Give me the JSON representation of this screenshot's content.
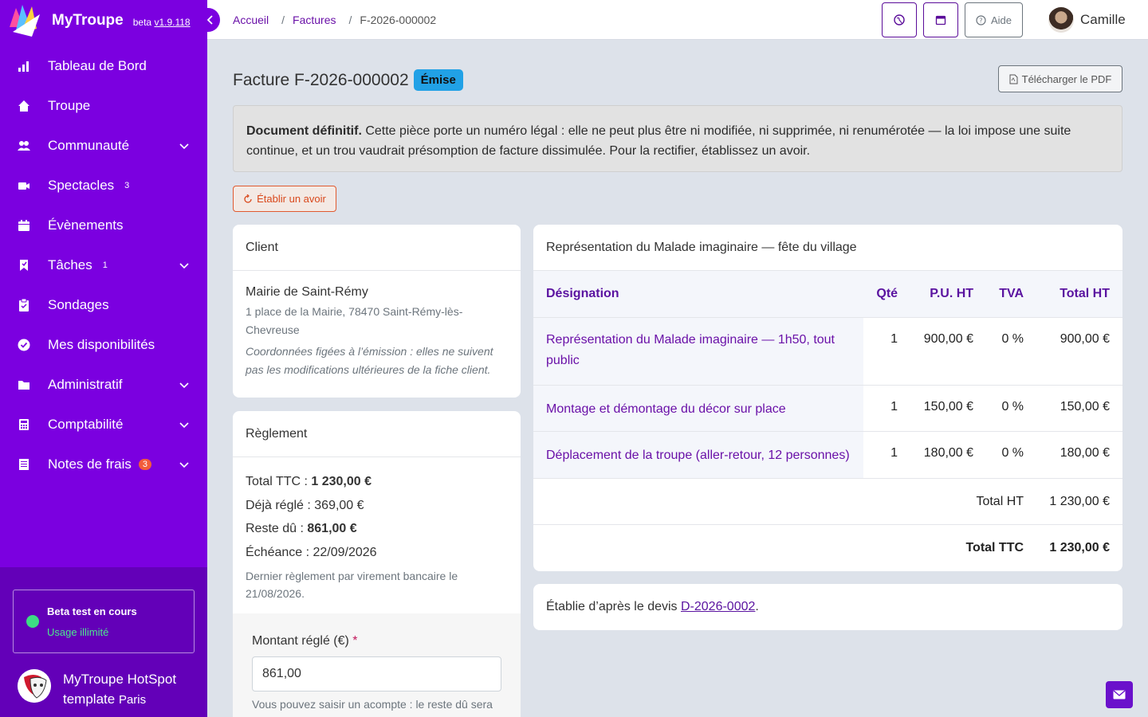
{
  "app": {
    "brand_name": "MyTroupe",
    "beta_prefix": "beta",
    "version": "v1.9.118"
  },
  "sidebar": {
    "items": [
      {
        "label": "Tableau de Bord",
        "icon": "bar-chart-icon"
      },
      {
        "label": "Troupe",
        "icon": "home-icon"
      },
      {
        "label": "Communauté",
        "icon": "users-icon",
        "chevron": true
      },
      {
        "label": "Spectacles",
        "icon": "video-icon",
        "badge": "3"
      },
      {
        "label": "Évènements",
        "icon": "calendar-icon"
      },
      {
        "label": "Tâches",
        "icon": "bookmark-icon",
        "badge": "1",
        "chevron": true
      },
      {
        "label": "Sondages",
        "icon": "clipboard-icon"
      },
      {
        "label": "Mes disponibilités",
        "icon": "check-circle-icon"
      },
      {
        "label": "Administratif",
        "icon": "folder-icon",
        "chevron": true
      },
      {
        "label": "Comptabilité",
        "icon": "calculator-icon",
        "chevron": true
      },
      {
        "label": "Notes de frais",
        "icon": "receipt-icon",
        "badge": "3",
        "badge_color": "#f25c3a",
        "chevron": true
      }
    ],
    "beta_box": {
      "title": "Beta test en cours",
      "subtitle": "Usage illimité"
    },
    "troupe": {
      "name": "MyTroupe HotSpot template",
      "city": "Paris"
    }
  },
  "topbar": {
    "breadcrumb": [
      "Accueil",
      "Factures",
      "F-2026-000002"
    ],
    "help_label": "Aide",
    "user_name": "Camille"
  },
  "invoice": {
    "title": "Facture F-2026-000002",
    "status": "Émise",
    "pdf_label": "Télécharger le PDF",
    "alert_bold": "Document définitif.",
    "alert_text": " Cette pièce porte un numéro légal : elle ne peut plus être ni modifiée, ni supprimée, ni renumérotée — la loi impose une suite continue, et un trou vaudrait présomption de facture dissimulée. Pour la rectifier, établissez un avoir.",
    "avoir_label": "Établir un avoir"
  },
  "client": {
    "header": "Client",
    "name": "Mairie de Saint-Rémy",
    "address": "1 place de la Mairie, 78470 Saint-Rémy-lès-Chevreuse",
    "note": "Coordonnées figées à l’émission : elles ne suivent pas les modifications ultérieures de la fiche client."
  },
  "reglement": {
    "header": "Règlement",
    "total_ttc_label": "Total TTC : ",
    "total_ttc_value": "1 230,00 €",
    "deja_regle": "Déjà réglé : 369,00 €",
    "reste_du_label": "Reste dû : ",
    "reste_du_value": "861,00 €",
    "echeance": "Échéance : 22/09/2026",
    "dernier": "Dernier règlement par virement bancaire le 21/08/2026.",
    "montant_label": "Montant réglé (€)",
    "required_mark": "*",
    "montant_value": "861,00",
    "help": "Vous pouvez saisir un acompte : le reste dû sera"
  },
  "lines": {
    "header": "Représentation du Malade imaginaire — fête du village",
    "columns": [
      "Désignation",
      "Qté",
      "P.U. HT",
      "TVA",
      "Total HT"
    ],
    "rows": [
      {
        "designation": "Représentation du Malade imaginaire — 1h50, tout public",
        "qte": "1",
        "pu": "900,00 €",
        "tva": "0 %",
        "total": "900,00 €"
      },
      {
        "designation": "Montage et démontage du décor sur place",
        "qte": "1",
        "pu": "150,00 €",
        "tva": "0 %",
        "total": "150,00 €"
      },
      {
        "designation": "Déplacement de la troupe (aller-retour, 12 personnes)",
        "qte": "1",
        "pu": "180,00 €",
        "tva": "0 %",
        "total": "180,00 €"
      }
    ],
    "total_ht_label": "Total HT",
    "total_ht_value": "1 230,00 €",
    "total_ttc_label": "Total TTC",
    "total_ttc_value": "1 230,00 €"
  },
  "devis": {
    "prefix": "Établie d’après le devis ",
    "link": "D-2026-0002",
    "suffix": "."
  }
}
